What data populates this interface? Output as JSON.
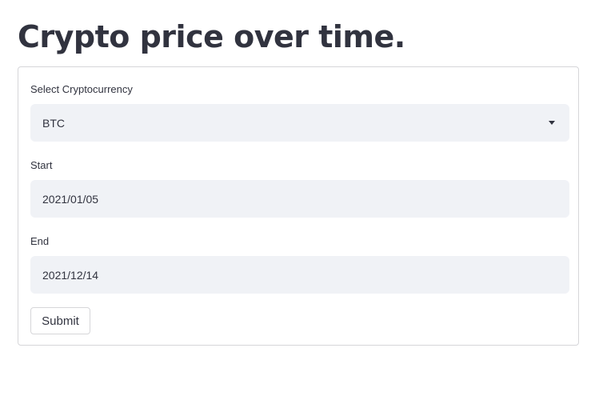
{
  "page": {
    "title": "Crypto price over time."
  },
  "form": {
    "crypto": {
      "label": "Select Cryptocurrency",
      "selected": "BTC",
      "icon": "chevron-down-icon"
    },
    "start": {
      "label": "Start",
      "value": "2021/01/05"
    },
    "end": {
      "label": "End",
      "value": "2021/12/14"
    },
    "submit_label": "Submit"
  },
  "colors": {
    "text": "#31333f",
    "field_bg": "#f0f2f6",
    "border": "#d6d6d9",
    "background": "#ffffff"
  }
}
